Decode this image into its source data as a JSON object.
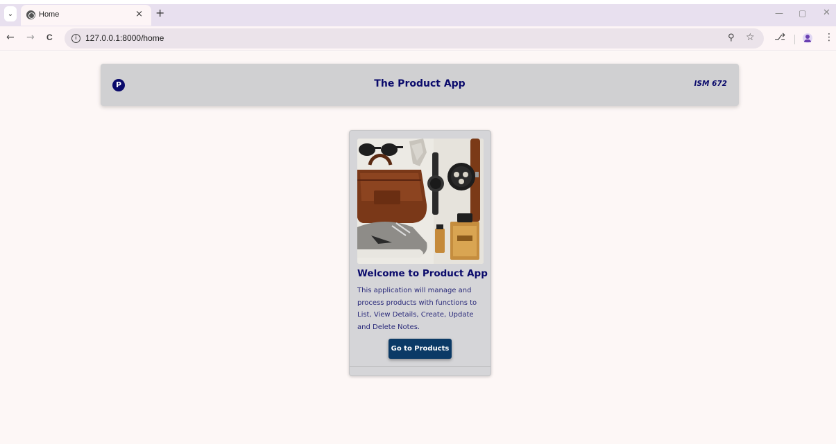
{
  "browser": {
    "tab_title": "Home",
    "tab_close": "×",
    "new_tab": "+",
    "url": "127.0.0.1:8000/home",
    "back": "←",
    "forward": "→",
    "reload": "C"
  },
  "app": {
    "logo_letter": "P",
    "title": "The Product App",
    "course": "ISM 672"
  },
  "card": {
    "title": "Welcome to Product App",
    "text": "This application will manage and process products with functions to List, View Details, Create, Update and Delete Notes.",
    "button_label": "Go to Products"
  },
  "colors": {
    "accent": "#0a0a6b",
    "button": "#0b3a66",
    "header_bg": "#d0d0d2",
    "page_bg": "#fdf7f6"
  }
}
